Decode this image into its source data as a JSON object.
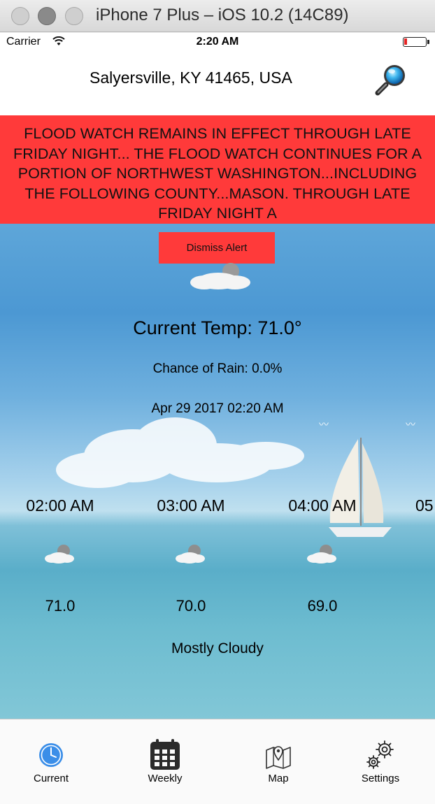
{
  "window": {
    "title": "iPhone 7 Plus – iOS 10.2 (14C89)"
  },
  "status_bar": {
    "carrier": "Carrier",
    "time": "2:20 AM"
  },
  "header": {
    "location": "Salyersville, KY 41465, USA",
    "search_icon": "magnifying-glass-icon"
  },
  "alert": {
    "text": "FLOOD WATCH REMAINS IN EFFECT THROUGH LATE FRIDAY NIGHT... THE FLOOD WATCH CONTINUES FOR A PORTION OF NORTHWEST WASHINGTON...INCLUDING THE FOLLOWING COUNTY...MASON. THROUGH LATE FRIDAY NIGHT A",
    "dismiss_label": "Dismiss Alert",
    "color": "#ff3a3a"
  },
  "current": {
    "temp": "Current Temp: 71.0°",
    "rain": "Chance of Rain: 0.0%",
    "datetime": "Apr 29 2017 02:20 AM",
    "condition": "Mostly Cloudy"
  },
  "hourly": [
    {
      "time": "02:00 AM",
      "temp": "71.0",
      "icon": "partly-cloudy-night-icon"
    },
    {
      "time": "03:00 AM",
      "temp": "70.0",
      "icon": "partly-cloudy-night-icon"
    },
    {
      "time": "04:00 AM",
      "temp": "69.0",
      "icon": "partly-cloudy-night-icon"
    },
    {
      "time": "05",
      "temp": "",
      "icon": ""
    }
  ],
  "tabs": [
    {
      "label": "Current",
      "icon": "clock-icon",
      "active": true
    },
    {
      "label": "Weekly",
      "icon": "calendar-icon",
      "active": false
    },
    {
      "label": "Map",
      "icon": "map-icon",
      "active": false
    },
    {
      "label": "Settings",
      "icon": "gear-icon",
      "active": false
    }
  ],
  "colors": {
    "accent": "#3b8ee8",
    "alert": "#ff3a3a"
  }
}
